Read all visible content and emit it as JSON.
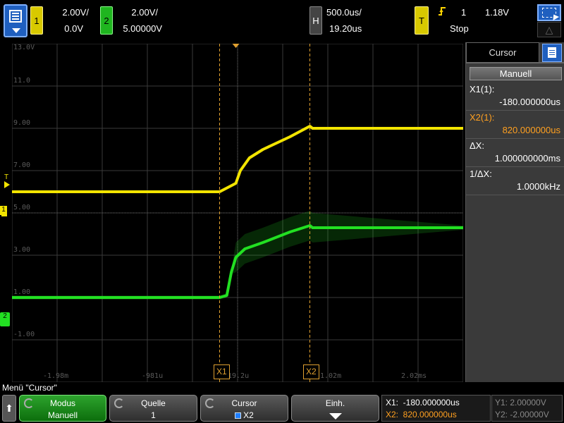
{
  "topbar": {
    "ch1": {
      "number": "1",
      "scale": "2.00V/",
      "offset": "0.0V"
    },
    "ch2": {
      "number": "2",
      "scale": "2.00V/",
      "offset": "5.00000V"
    },
    "horizontal": {
      "tag": "H",
      "scale": "500.0us/",
      "delay": "19.20us"
    },
    "trigger": {
      "tag": "T",
      "source": "1",
      "level": "1.18V",
      "state": "Stop"
    }
  },
  "plot": {
    "y_labels": [
      "13.0V",
      "11.0",
      "9.00",
      "7.00",
      "5.00",
      "3.00",
      "1.00",
      "-1.00"
    ],
    "x_labels": [
      "-1.98m",
      "-981u",
      "19.2u",
      "1.02m",
      "2.02ms"
    ],
    "left_markers": {
      "trigger": "T",
      "ch1": "1",
      "ch2": "2"
    },
    "cursor_tags": {
      "x1": "X1",
      "x2": "X2"
    },
    "colors": {
      "ch1": "#f2e400",
      "ch2": "#22e022",
      "grid": "#3a3a3a",
      "cursor": "#e0a030"
    }
  },
  "chart_data": {
    "type": "line",
    "title": "",
    "xlabel": "",
    "ylabel": "",
    "x_unit": "us",
    "y_unit": "V",
    "xlim": [
      -2480.8,
      2519.2
    ],
    "ylim": [
      -4.0,
      12.0
    ],
    "series": [
      {
        "x": [
          -2480.8,
          -180,
          0,
          50,
          150,
          300,
          600,
          820,
          850,
          2519.2
        ],
        "values": [
          5.0,
          5.0,
          5.4,
          6.0,
          6.6,
          7.0,
          7.6,
          8.1,
          8.0,
          8.0
        ]
      },
      {
        "x": [
          -2480.8,
          -180,
          -100,
          -50,
          0,
          100,
          300,
          600,
          820,
          850,
          2519.2
        ],
        "values": [
          0.0,
          0.0,
          0.1,
          1.2,
          1.9,
          2.3,
          2.6,
          3.1,
          3.4,
          3.3,
          3.3
        ]
      }
    ],
    "cursors": {
      "x1": -180.0,
      "x2": 820.0
    },
    "grid": true
  },
  "panel": {
    "tab_title": "Cursor",
    "mode_button": "Manuell",
    "rows": [
      {
        "label": "X1(1):",
        "value": "-180.000000us",
        "color": "#ffffff"
      },
      {
        "label": "X2(1):",
        "value": "820.000000us",
        "color": "#ffa020"
      },
      {
        "label": "ΔX:",
        "value": "1.000000000ms",
        "color": "#ffffff"
      },
      {
        "label": "1/ΔX:",
        "value": "1.0000kHz",
        "color": "#ffffff"
      }
    ]
  },
  "menu": {
    "title": "Menü \"Cursor\"",
    "softkeys": [
      {
        "top": "Modus",
        "bottom": "Manuell"
      },
      {
        "top": "Quelle",
        "bottom": "1"
      },
      {
        "top": "Cursor",
        "bottom": "X2"
      },
      {
        "top": "Einh.",
        "bottom": ""
      }
    ],
    "readout": {
      "x1": "X1:  -180.000000us",
      "x2": "X2:  820.000000us",
      "y1": "Y1: 2.00000V",
      "y2": "Y2: -2.00000V"
    }
  }
}
